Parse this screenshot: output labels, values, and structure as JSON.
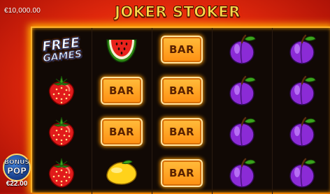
{
  "header": {
    "balance": "€10,000.00",
    "logo_text": "JOKER STOKER"
  },
  "reels": [
    {
      "reel": 1,
      "symbols": [
        "free-games",
        "strawberry",
        "strawberry",
        "strawberry"
      ]
    },
    {
      "reel": 2,
      "symbols": [
        "watermelon",
        "bar",
        "bar",
        "lemon"
      ]
    },
    {
      "reel": 3,
      "symbols": [
        "bar",
        "bar",
        "bar",
        "bar"
      ]
    },
    {
      "reel": 4,
      "symbols": [
        "plum",
        "plum",
        "plum",
        "plum"
      ]
    },
    {
      "reel": 5,
      "symbols": [
        "plum",
        "plum",
        "plum",
        "plum"
      ]
    }
  ],
  "symbol_labels": {
    "bar": "BAR",
    "free_games_line1": "FREE",
    "free_games_line2": "GAMES"
  },
  "bonus_pop": {
    "line1": "BONUS",
    "line2": "POP",
    "price": "€22.00"
  },
  "colors": {
    "background": "#e0280c",
    "frame_glow": "#ffb800",
    "bar_plate": "#ff9a1a",
    "logo": "#ffd84a"
  }
}
